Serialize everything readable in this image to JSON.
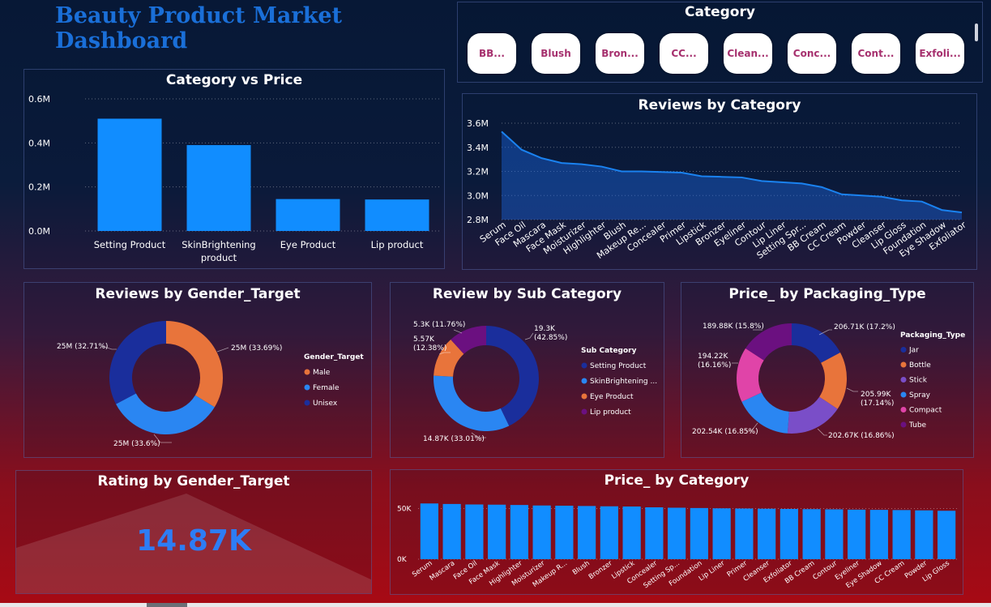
{
  "dashboard": {
    "title": "Beauty Product Market Dashboard"
  },
  "slicer": {
    "title": "Category",
    "items": [
      "BB...",
      "Blush",
      "Bron...",
      "CC...",
      "Clean...",
      "Conc...",
      "Cont...",
      "Exfoli..."
    ]
  },
  "colors": {
    "bar": "#118dff",
    "area_line": "#1a82f0",
    "title_blue": "#1a6fd8",
    "slicer_text": "#a6306e",
    "card_value": "#2d7df5"
  },
  "panels": {
    "category_price": {
      "title": "Category vs Price"
    },
    "reviews_category": {
      "title": "Reviews by Category"
    },
    "reviews_gender": {
      "title": "Reviews by Gender_Target"
    },
    "review_subcat": {
      "title": "Review by Sub Category"
    },
    "price_packaging": {
      "title": "Price_ by Packaging_Type"
    },
    "rating_gender": {
      "title": "Rating by Gender_Target",
      "value": "14.87K"
    },
    "price_category": {
      "title": "Price_ by Category"
    }
  },
  "chart_data": [
    {
      "id": "category_price",
      "type": "bar",
      "title": "Category vs Price",
      "categories": [
        "Setting Product",
        "SkinBrightening product",
        "Eye Product",
        "Lip product"
      ],
      "values": [
        0.51,
        0.39,
        0.145,
        0.143
      ],
      "unit": "M",
      "yticks": [
        "0.0M",
        "0.2M",
        "0.4M",
        "0.6M"
      ],
      "ylim": [
        0,
        0.6
      ],
      "grid": true
    },
    {
      "id": "reviews_category",
      "type": "area",
      "title": "Reviews by Category",
      "categories": [
        "Serum",
        "Face Oil",
        "Mascara",
        "Face Mask",
        "Moisturizer",
        "Highlighter",
        "Blush",
        "Makeup Re...",
        "Concealer",
        "Primer",
        "Lipstick",
        "Bronzer",
        "Eyeliner",
        "Contour",
        "Lip Liner",
        "Setting Spr...",
        "BB Cream",
        "CC Cream",
        "Powder",
        "Cleanser",
        "Lip Gloss",
        "Foundation",
        "Eye Shadow",
        "Exfoliator"
      ],
      "values": [
        3.53,
        3.38,
        3.31,
        3.27,
        3.26,
        3.24,
        3.2,
        3.2,
        3.195,
        3.19,
        3.16,
        3.155,
        3.15,
        3.12,
        3.11,
        3.1,
        3.07,
        3.01,
        3.0,
        2.99,
        2.96,
        2.95,
        2.88,
        2.86
      ],
      "unit": "M",
      "yticks": [
        "2.8M",
        "3.0M",
        "3.2M",
        "3.4M",
        "3.6M"
      ],
      "ylim": [
        2.8,
        3.6
      ],
      "grid": true
    },
    {
      "id": "reviews_gender",
      "type": "pie",
      "donut": true,
      "title": "Reviews by Gender_Target",
      "legend_title": "Gender_Target",
      "legend_position": "right",
      "slices": [
        {
          "name": "Male",
          "value": 33.69,
          "label": "25M (33.69%)",
          "color": "#e8743b"
        },
        {
          "name": "Female",
          "value": 33.6,
          "label": "25M (33.6%)",
          "color": "#2a86f2"
        },
        {
          "name": "Unisex",
          "value": 32.71,
          "label": "25M (32.71%)",
          "color": "#1a2e9c"
        }
      ]
    },
    {
      "id": "review_subcat",
      "type": "pie",
      "donut": true,
      "title": "Review by Sub Category",
      "legend_title": "Sub Category",
      "legend_position": "right",
      "slices": [
        {
          "name": "Setting Product",
          "value": 42.85,
          "label": "19.3K (42.85%)",
          "color": "#1a2e9c"
        },
        {
          "name": "SkinBrightening ...",
          "value": 33.01,
          "label": "14.87K (33.01%)",
          "color": "#2a86f2"
        },
        {
          "name": "Eye Product",
          "value": 12.38,
          "label": "5.57K (12.38%)",
          "color": "#e8743b"
        },
        {
          "name": "Lip product",
          "value": 11.76,
          "label": "5.3K (11.76%)",
          "color": "#6b1080"
        }
      ]
    },
    {
      "id": "price_packaging",
      "type": "pie",
      "donut": true,
      "title": "Price_ by Packaging_Type",
      "legend_title": "Packaging_Type",
      "legend_position": "right",
      "slices": [
        {
          "name": "Jar",
          "value": 17.2,
          "label": "206.71K (17.2%)",
          "color": "#1a2e9c"
        },
        {
          "name": "Bottle",
          "value": 17.14,
          "label": "205.99K (17.14%)",
          "color": "#e8743b"
        },
        {
          "name": "Stick",
          "value": 16.86,
          "label": "202.67K (16.86%)",
          "color": "#7a4ec8"
        },
        {
          "name": "Spray",
          "value": 16.85,
          "label": "202.54K (16.85%)",
          "color": "#2a86f2"
        },
        {
          "name": "Compact",
          "value": 16.16,
          "label": "194.22K (16.16%)",
          "color": "#e044a8"
        },
        {
          "name": "Tube",
          "value": 15.8,
          "label": "189.88K (15.8%)",
          "color": "#6b1080"
        }
      ]
    },
    {
      "id": "price_category",
      "type": "bar",
      "title": "Price_ by Category",
      "categories": [
        "Serum",
        "Mascara",
        "Face Oil",
        "Face Mask",
        "Highlighter",
        "Moisturizer",
        "Makeup R...",
        "Blush",
        "Bronzer",
        "Lipstick",
        "Concealer",
        "Setting Sp...",
        "Foundation",
        "Lip Liner",
        "Primer",
        "Cleanser",
        "Exfoliator",
        "BB Cream",
        "Contour",
        "Eyeliner",
        "Eye Shadow",
        "CC Cream",
        "Powder",
        "Lip Gloss"
      ],
      "values": [
        55,
        54.5,
        54,
        53.8,
        53.5,
        53,
        52.8,
        52.5,
        52.2,
        52,
        51.2,
        50.8,
        50.5,
        50.2,
        50,
        49.8,
        49.6,
        49.4,
        49.2,
        48.9,
        48.7,
        48.5,
        48.2,
        47.8
      ],
      "unit": "K",
      "yticks": [
        "0K",
        "50K"
      ],
      "ylim": [
        0,
        60
      ],
      "grid": true
    }
  ]
}
